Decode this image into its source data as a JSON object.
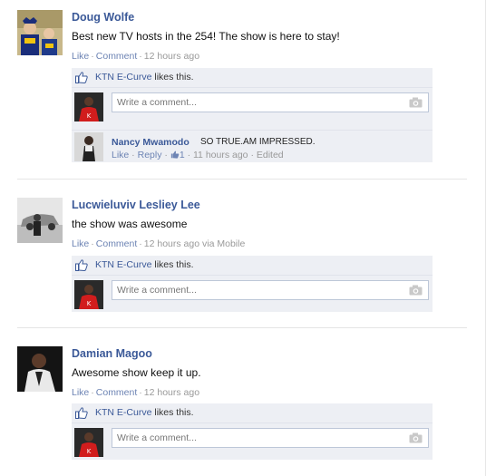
{
  "icons": {
    "like": "thumbs-up-icon",
    "camera": "camera-icon"
  },
  "colors": {
    "link": "#3b5998",
    "ufi_background": "#edeff4",
    "meta_text": "#999999"
  },
  "posts": [
    {
      "author": "Doug Wolfe",
      "text": "Best new TV hosts in the 254! The show is here to stay!",
      "actions": {
        "like": "Like",
        "comment": "Comment"
      },
      "time": "12 hours ago",
      "via": "",
      "likers_link": "KTN E-Curve",
      "likes_suffix": " likes this.",
      "comment_placeholder": "Write a comment...",
      "reply": {
        "author": "Nancy Mwamodo",
        "text": "SO TRUE.AM IMPRESSED.",
        "like": "Like",
        "reply_label": "Reply",
        "like_count": "1",
        "time": "11 hours ago",
        "edited": "Edited"
      }
    },
    {
      "author": "Lucwieluviv Lesliey Lee",
      "text": "the show was awesome",
      "actions": {
        "like": "Like",
        "comment": "Comment"
      },
      "time": "12 hours ago",
      "via": "via Mobile",
      "likers_link": "KTN E-Curve",
      "likes_suffix": " likes this.",
      "comment_placeholder": "Write a comment..."
    },
    {
      "author": "Damian Magoo",
      "text": "Awesome show keep it up.",
      "actions": {
        "like": "Like",
        "comment": "Comment"
      },
      "time": "12 hours ago",
      "via": "",
      "likers_link": "KTN E-Curve",
      "likes_suffix": " likes this.",
      "comment_placeholder": "Write a comment..."
    }
  ]
}
